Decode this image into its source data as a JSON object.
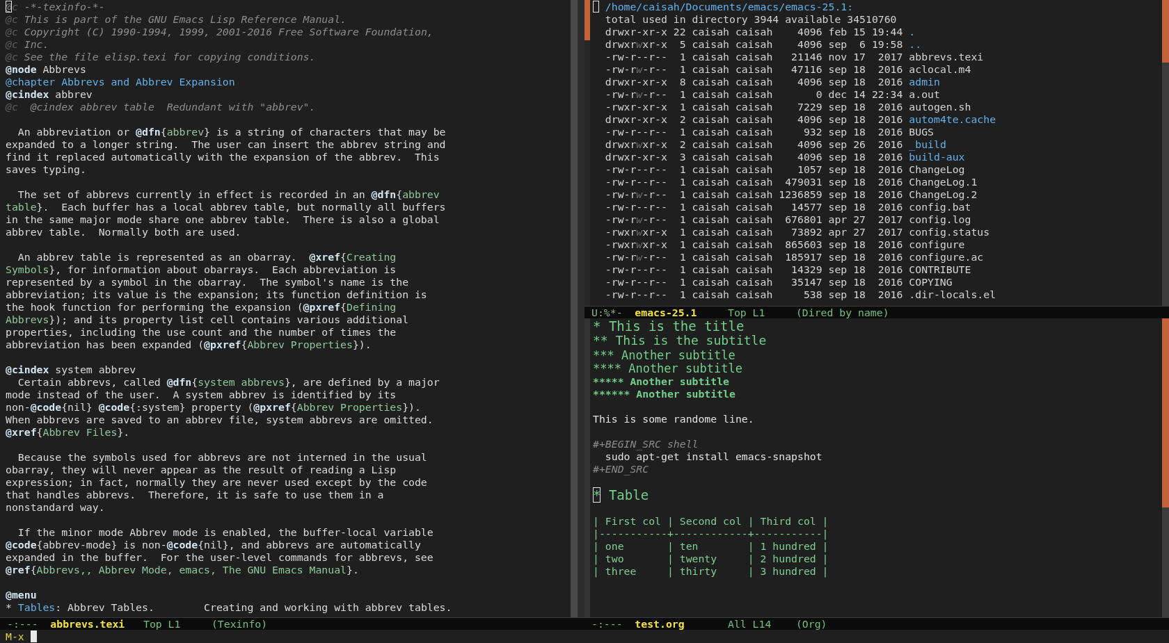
{
  "texinfo_buffer": {
    "lines": [
      {
        "kind": "comment",
        "segments": [
          {
            "kind": "cursor",
            "text": "@"
          },
          {
            "kind": "cdelim",
            "text": "c"
          },
          {
            "kind": "comment",
            "text": " -*-texinfo-*-"
          }
        ]
      },
      {
        "kind": "comment",
        "segments": [
          {
            "kind": "cdelim",
            "text": "@c"
          },
          {
            "kind": "comment",
            "text": " This is part of the GNU Emacs Lisp Reference Manual."
          }
        ]
      },
      {
        "kind": "comment",
        "segments": [
          {
            "kind": "cdelim",
            "text": "@c"
          },
          {
            "kind": "comment",
            "text": " Copyright (C) 1990-1994, 1999, 2001-2016 Free Software Foundation,"
          }
        ]
      },
      {
        "kind": "comment",
        "segments": [
          {
            "kind": "cdelim",
            "text": "@c"
          },
          {
            "kind": "comment",
            "text": " Inc."
          }
        ]
      },
      {
        "kind": "comment",
        "segments": [
          {
            "kind": "cdelim",
            "text": "@c"
          },
          {
            "kind": "comment",
            "text": " See the file elisp.texi for copying conditions."
          }
        ]
      },
      {
        "kind": "source",
        "segments": [
          {
            "kind": "kw",
            "text": "@node"
          },
          " Abbrevs"
        ]
      },
      {
        "kind": "source",
        "segments": [
          {
            "kind": "chapter",
            "text": "@chapter Abbrevs and Abbrev Expansion"
          }
        ]
      },
      {
        "kind": "source",
        "segments": [
          {
            "kind": "kw",
            "text": "@cindex"
          },
          " abbrev"
        ]
      },
      {
        "kind": "comment",
        "segments": [
          {
            "kind": "cdelim",
            "text": "@c"
          },
          {
            "kind": "comment",
            "text": "  @cindex abbrev table  Redundant with \"abbrev\"."
          }
        ]
      },
      {
        "kind": "blank"
      },
      {
        "kind": "source",
        "segments": [
          "  An abbreviation or ",
          {
            "kind": "kw",
            "text": "@dfn"
          },
          "{",
          {
            "kind": "arg",
            "text": "abbrev"
          },
          "} is a string of characters that may be"
        ]
      },
      {
        "kind": "source",
        "segments": [
          "expanded to a longer string.  The user can insert the abbrev string and"
        ]
      },
      {
        "kind": "source",
        "segments": [
          "find it replaced automatically with the expansion of the abbrev.  This"
        ]
      },
      {
        "kind": "source",
        "segments": [
          "saves typing."
        ]
      },
      {
        "kind": "blank"
      },
      {
        "kind": "source",
        "segments": [
          "  The set of abbrevs currently in effect is recorded in an ",
          {
            "kind": "kw",
            "text": "@dfn"
          },
          "{",
          {
            "kind": "arg",
            "text": "abbrev"
          }
        ]
      },
      {
        "kind": "source",
        "segments": [
          {
            "kind": "arg",
            "text": "table"
          },
          "}.  Each buffer has a local abbrev table, but normally all buffers"
        ]
      },
      {
        "kind": "source",
        "segments": [
          "in the same major mode share one abbrev table.  There is also a global"
        ]
      },
      {
        "kind": "source",
        "segments": [
          "abbrev table.  Normally both are used."
        ]
      },
      {
        "kind": "blank"
      },
      {
        "kind": "source",
        "segments": [
          "  An abbrev table is represented as an obarray.  ",
          {
            "kind": "kw",
            "text": "@xref"
          },
          "{",
          {
            "kind": "arg",
            "text": "Creating"
          }
        ]
      },
      {
        "kind": "source",
        "segments": [
          {
            "kind": "arg",
            "text": "Symbols"
          },
          "}, for information about obarrays.  Each abbreviation is"
        ]
      },
      {
        "kind": "source",
        "segments": [
          "represented by a symbol in the obarray.  The symbol's name is the"
        ]
      },
      {
        "kind": "source",
        "segments": [
          "abbreviation; its value is the expansion; its function definition is"
        ]
      },
      {
        "kind": "source",
        "segments": [
          "the hook function for performing the expansion (",
          {
            "kind": "kw",
            "text": "@pxref"
          },
          "{",
          {
            "kind": "arg",
            "text": "Defining"
          }
        ]
      },
      {
        "kind": "source",
        "segments": [
          {
            "kind": "arg",
            "text": "Abbrevs"
          },
          "}); and its property list cell contains various additional"
        ]
      },
      {
        "kind": "source",
        "segments": [
          "properties, including the use count and the number of times the"
        ]
      },
      {
        "kind": "source",
        "segments": [
          "abbreviation has been expanded (",
          {
            "kind": "kw",
            "text": "@pxref"
          },
          "{",
          {
            "kind": "arg",
            "text": "Abbrev Properties"
          },
          "})."
        ]
      },
      {
        "kind": "blank"
      },
      {
        "kind": "source",
        "segments": [
          {
            "kind": "kw",
            "text": "@cindex"
          },
          " system abbrev"
        ]
      },
      {
        "kind": "source",
        "segments": [
          "  Certain abbrevs, called ",
          {
            "kind": "kw",
            "text": "@dfn"
          },
          "{",
          {
            "kind": "arg",
            "text": "system abbrevs"
          },
          "}, are defined by a major"
        ]
      },
      {
        "kind": "source",
        "segments": [
          "mode instead of the user.  A system abbrev is identified by its"
        ]
      },
      {
        "kind": "source",
        "segments": [
          "non-",
          {
            "kind": "kw",
            "text": "@code"
          },
          "{nil} ",
          {
            "kind": "kw",
            "text": "@code"
          },
          "{:system} property (",
          {
            "kind": "kw",
            "text": "@pxref"
          },
          "{",
          {
            "kind": "arg",
            "text": "Abbrev Properties"
          },
          "})."
        ]
      },
      {
        "kind": "source",
        "segments": [
          "When abbrevs are saved to an abbrev file, system abbrevs are omitted."
        ]
      },
      {
        "kind": "source",
        "segments": [
          {
            "kind": "kw",
            "text": "@xref"
          },
          "{",
          {
            "kind": "arg",
            "text": "Abbrev Files"
          },
          "}."
        ]
      },
      {
        "kind": "blank"
      },
      {
        "kind": "source",
        "segments": [
          "  Because the symbols used for abbrevs are not interned in the usual"
        ]
      },
      {
        "kind": "source",
        "segments": [
          "obarray, they will never appear as the result of reading a Lisp"
        ]
      },
      {
        "kind": "source",
        "segments": [
          "expression; in fact, normally they are never used except by the code"
        ]
      },
      {
        "kind": "source",
        "segments": [
          "that handles abbrevs.  Therefore, it is safe to use them in a"
        ]
      },
      {
        "kind": "source",
        "segments": [
          "nonstandard way."
        ]
      },
      {
        "kind": "blank"
      },
      {
        "kind": "source",
        "segments": [
          "  If the minor mode Abbrev mode is enabled, the buffer-local variable"
        ]
      },
      {
        "kind": "source",
        "segments": [
          {
            "kind": "kw",
            "text": "@code"
          },
          "{abbrev-mode} is non-",
          {
            "kind": "kw",
            "text": "@code"
          },
          "{nil}, and abbrevs are automatically"
        ]
      },
      {
        "kind": "source",
        "segments": [
          "expanded in the buffer.  For the user-level commands for abbrevs, see"
        ]
      },
      {
        "kind": "source",
        "segments": [
          {
            "kind": "kw",
            "text": "@ref"
          },
          "{",
          {
            "kind": "arg",
            "text": "Abbrevs,, Abbrev Mode, emacs, The GNU Emacs Manual"
          },
          "}."
        ]
      },
      {
        "kind": "blank"
      },
      {
        "kind": "source",
        "segments": [
          {
            "kind": "kw",
            "text": "@menu"
          }
        ]
      },
      {
        "kind": "source",
        "segments": [
          "* ",
          {
            "kind": "link",
            "text": "Tables"
          },
          ": Abbrev Tables.        Creating and working with abbrev tables."
        ]
      }
    ],
    "mode_line": {
      "status": "-:---",
      "buffer": "abbrevs.texi",
      "position": "Top L1",
      "mode": "(Texinfo)"
    }
  },
  "dired_buffer": {
    "lines": [
      {
        "kind": "header",
        "segments": [
          {
            "kind": "cursor"
          },
          {
            "kind": "dir",
            "text": "/home/caisah/Documents/emacs/emacs-25.1:"
          }
        ]
      },
      {
        "kind": "summary",
        "segments": [
          "  total used in directory 3944 available 34510760"
        ]
      },
      {
        "kind": "file",
        "segments": [
          "  drwxr-xr-x 22 caisah caisah    4096 feb 15 19:44 ",
          {
            "kind": "dir",
            "text": "."
          }
        ]
      },
      {
        "kind": "file",
        "segments": [
          "  drwxr",
          {
            "kind": "dim",
            "text": "w"
          },
          "xr-x  5 caisah caisah    4096 sep  6 19:58 ",
          {
            "kind": "dir",
            "text": ".."
          }
        ]
      },
      {
        "kind": "file",
        "segments": [
          "  -rw-r--r--  1 caisah caisah   21146 nov 17  2017 abbrevs.texi"
        ]
      },
      {
        "kind": "file",
        "segments": [
          "  -rw-r",
          {
            "kind": "dim",
            "text": "w"
          },
          "-r--  1 caisah caisah   47116 sep 18  2016 aclocal.m4"
        ]
      },
      {
        "kind": "file",
        "segments": [
          "  drwxr-xr-x  8 caisah caisah    4096 sep 18  2016 ",
          {
            "kind": "dir",
            "text": "admin"
          }
        ]
      },
      {
        "kind": "file",
        "segments": [
          "  -rw-r",
          {
            "kind": "dim",
            "text": "w"
          },
          "-r--  1 caisah caisah       0 dec 14 22:34 a.out"
        ]
      },
      {
        "kind": "file",
        "segments": [
          "  -rwxr-xr-x  1 caisah caisah    7229 sep 18  2016 autogen.sh"
        ]
      },
      {
        "kind": "file",
        "segments": [
          "  drwxr-xr-x  2 caisah caisah    4096 sep 18  2016 ",
          {
            "kind": "dir",
            "text": "autom4te.cache"
          }
        ]
      },
      {
        "kind": "file",
        "segments": [
          "  -rw-r--r--  1 caisah caisah     932 sep 18  2016 BUGS"
        ]
      },
      {
        "kind": "file",
        "segments": [
          "  drwxr",
          {
            "kind": "dim",
            "text": "w"
          },
          "xr-x  2 caisah caisah    4096 sep 26  2016 ",
          {
            "kind": "dir",
            "text": "_build"
          }
        ]
      },
      {
        "kind": "file",
        "segments": [
          "  drwxr-xr-x  3 caisah caisah    4096 sep 18  2016 ",
          {
            "kind": "dir",
            "text": "build-aux"
          }
        ]
      },
      {
        "kind": "file",
        "segments": [
          "  -rw-r--r--  1 caisah caisah    1057 sep 18  2016 ChangeLog"
        ]
      },
      {
        "kind": "file",
        "segments": [
          "  -rw-r--r--  1 caisah caisah  479031 sep 18  2016 ChangeLog.1"
        ]
      },
      {
        "kind": "file",
        "segments": [
          "  -rw-r",
          {
            "kind": "dim",
            "text": "w"
          },
          "-r--  1 caisah caisah 1236859 sep 18  2016 ChangeLog.2"
        ]
      },
      {
        "kind": "file",
        "segments": [
          "  -rw-r--r--  1 caisah caisah   14577 sep 18  2016 config.bat"
        ]
      },
      {
        "kind": "file",
        "segments": [
          "  -rw-r",
          {
            "kind": "dim",
            "text": "w"
          },
          "-r--  1 caisah caisah  676801 apr 27  2017 config.log"
        ]
      },
      {
        "kind": "file",
        "segments": [
          "  -rwxr",
          {
            "kind": "dim",
            "text": "w"
          },
          "xr-x  1 caisah caisah   73892 apr 27  2017 config.status"
        ]
      },
      {
        "kind": "file",
        "segments": [
          "  -rwxr",
          {
            "kind": "dim",
            "text": "w"
          },
          "xr-x  1 caisah caisah  865603 sep 18  2016 configure"
        ]
      },
      {
        "kind": "file",
        "segments": [
          "  -rw-r",
          {
            "kind": "dim",
            "text": "w"
          },
          "-r--  1 caisah caisah  185917 sep 18  2016 configure.ac"
        ]
      },
      {
        "kind": "file",
        "segments": [
          "  -rw-r--r--  1 caisah caisah   14329 sep 18  2016 CONTRIBUTE"
        ]
      },
      {
        "kind": "file",
        "segments": [
          "  -rw-r--r--  1 caisah caisah   35147 sep 18  2016 COPYING"
        ]
      },
      {
        "kind": "file",
        "segments": [
          "  -rw-r--r--  1 caisah caisah     538 sep 18  2016 .dir-locals.el"
        ]
      }
    ],
    "mode_line": {
      "status": "U:%*-",
      "buffer": "emacs-25.1",
      "position": "Top L1",
      "mode": "(Dired by name)"
    }
  },
  "org_buffer": {
    "lines": [
      {
        "kind": "h1",
        "segments": [
          "* This is the title"
        ]
      },
      {
        "kind": "h2",
        "segments": [
          "** This is the subtitle"
        ]
      },
      {
        "kind": "h3",
        "segments": [
          "*** Another subtitle"
        ]
      },
      {
        "kind": "h4",
        "segments": [
          "**** Another subtitle"
        ]
      },
      {
        "kind": "h5",
        "segments": [
          "***** Another subtitle"
        ]
      },
      {
        "kind": "h6",
        "segments": [
          "****** Another subtitle"
        ]
      },
      {
        "kind": "blank"
      },
      {
        "kind": "text",
        "segments": [
          "This is some randome line."
        ]
      },
      {
        "kind": "blank"
      },
      {
        "kind": "meta",
        "segments": [
          "#+BEGIN_SRC shell"
        ]
      },
      {
        "kind": "text",
        "segments": [
          "  sudo apt-get install emacs-snapshot"
        ]
      },
      {
        "kind": "meta",
        "segments": [
          "#+END_SRC"
        ]
      },
      {
        "kind": "blank"
      },
      {
        "kind": "h1",
        "segments": [
          {
            "kind": "cursor",
            "text": "*"
          },
          " Table"
        ]
      },
      {
        "kind": "blank"
      },
      {
        "kind": "table",
        "segments": [
          "| First col | Second col | Third col |"
        ]
      },
      {
        "kind": "rule",
        "segments": [
          "|-----------+------------+-----------|"
        ]
      },
      {
        "kind": "table",
        "segments": [
          "| one       | ten        | 1 hundred |"
        ]
      },
      {
        "kind": "table",
        "segments": [
          "| two       | twenty     | 2 hundred |"
        ]
      },
      {
        "kind": "table",
        "segments": [
          "| three     | thirty     | 3 hundred |"
        ]
      }
    ],
    "mode_line": {
      "status": "-:---",
      "buffer": "test.org",
      "position": "All L14",
      "mode": "(Org)"
    }
  },
  "minibuffer": {
    "prompt": "M-x"
  }
}
